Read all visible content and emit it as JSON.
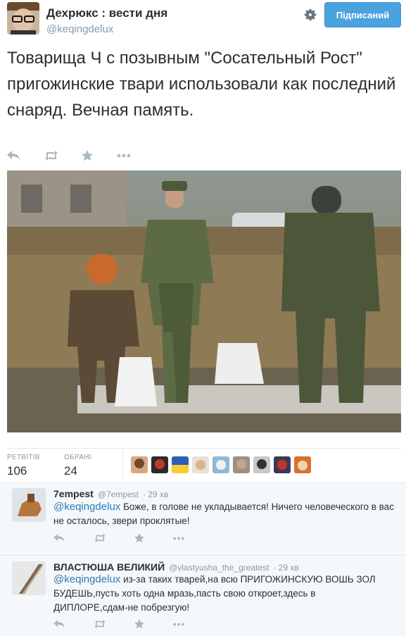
{
  "tweet": {
    "author_name": "Дехрюкс : вести дня",
    "author_handle": "@keqingdelux",
    "follow_label": "Підписаний",
    "text": "Товарища Ч с позывным \"Сосательный Рост\" пригожинские твари использовали как последний снаряд. Вечная память.",
    "icons": [
      "reply-icon",
      "retweet-icon",
      "favorite-icon",
      "more-icon"
    ]
  },
  "stats": {
    "retweets_label": "РЕТВІТІВ",
    "retweets": "106",
    "favorites_label": "ОБРАНІ",
    "favorites": "24",
    "favoriter_count": 9
  },
  "replies": [
    {
      "name": "7empest",
      "handle": "@7empest",
      "time": "· 29 хв",
      "mention": "@keqingdelux",
      "text": "Боже, в голове не укладывается! Ничего человеческого в вас не осталось, звери проклятые!"
    },
    {
      "name": "ВЛАСТЮША ВЕЛИКИЙ",
      "handle": "@vlastyusha_the_greatest",
      "time": "· 29 хв",
      "mention": "@keqingdelux",
      "text": "из-за таких тварей,на всю ПРИГОЖИНСКУЮ ВОШЬ ЗОЛ БУДЕШЬ,пусть хоть одна мразь,пасть свою откроет,здесь в ДИПЛОРЕ,сдам-не побрезгую!"
    }
  ],
  "colors": {
    "follow_bg": "#4aa3df",
    "link": "#2b7bb9",
    "muted": "#8899a6",
    "icon": "#aab8c2"
  }
}
